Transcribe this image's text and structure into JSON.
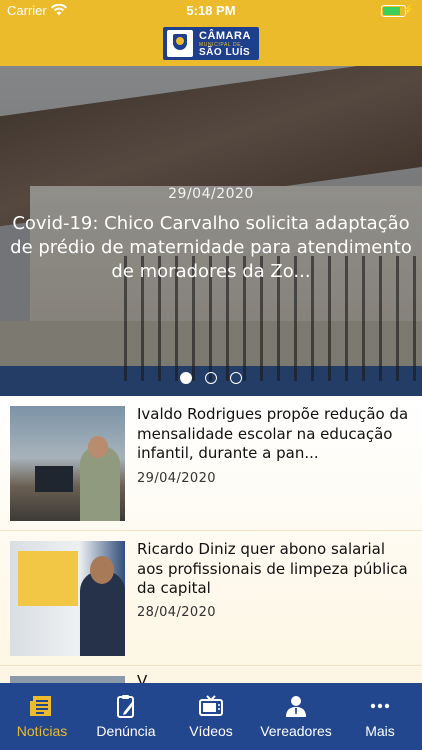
{
  "status_bar": {
    "carrier": "Carrier",
    "time": "5:18 PM",
    "battery_level": 0.8
  },
  "header": {
    "logo_line1": "CÂMARA",
    "logo_line2": "MUNICIPAL DE",
    "logo_line3": "SÃO LUÍS"
  },
  "hero": {
    "date": "29/04/2020",
    "title": "Covid-19: Chico Carvalho solicita adaptação de prédio de maternidade para atendimento de moradores da Zo...",
    "slide_count": 3,
    "active_slide": 1
  },
  "news": [
    {
      "title": "Ivaldo Rodrigues propõe redução da mensalidade escolar na educação infantil, durante a pan...",
      "date": "29/04/2020"
    },
    {
      "title": "Ricardo Diniz quer abono salarial aos profissionais de limpeza pública da capital",
      "date": "28/04/2020"
    }
  ],
  "peek_title": "V",
  "tabs": [
    {
      "label": "Notícias",
      "icon": "newspaper-icon",
      "active": true
    },
    {
      "label": "Denúncia",
      "icon": "clipboard-pen-icon",
      "active": false
    },
    {
      "label": "Vídeos",
      "icon": "tv-icon",
      "active": false
    },
    {
      "label": "Vereadores",
      "icon": "person-icon",
      "active": false
    },
    {
      "label": "Mais",
      "icon": "more-icon",
      "active": false
    }
  ],
  "colors": {
    "brand_yellow": "#ecbb2b",
    "brand_blue": "#22478f",
    "battery_green": "#3cd05a"
  }
}
